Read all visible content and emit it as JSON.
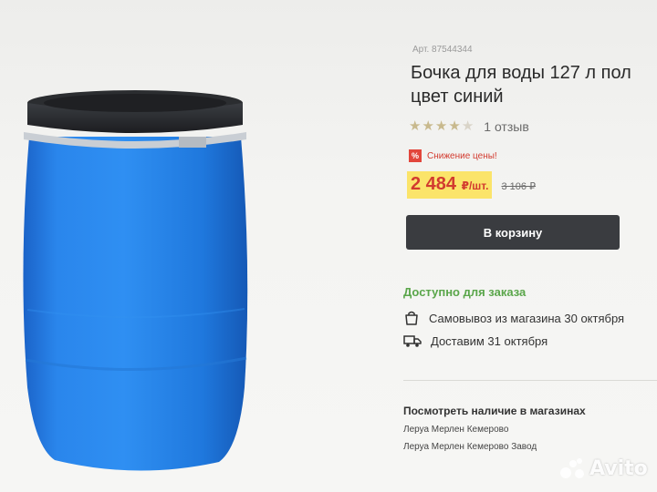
{
  "product": {
    "article": "Арт. 87544344",
    "title_line1": "Бочка для воды 127 л пол",
    "title_line2": "цвет синий",
    "rating": 4,
    "rating_max": 5,
    "reviews": "1 отзыв",
    "promo_badge": "%",
    "promo_text": "Снижение цены!",
    "price": "2 484",
    "price_unit": "₽/шт.",
    "old_price": "3 106 ₽",
    "cart_button": "В корзину"
  },
  "availability": {
    "status": "Доступно для заказа",
    "pickup": "Самовывоз из магазина 30 октября",
    "delivery": "Доставим 31 октября"
  },
  "stores": {
    "title": "Посмотреть наличие в магазинах",
    "items": [
      "Леруа Мерлен Кемерово",
      "Леруа Мерлен Кемерово Завод"
    ]
  },
  "watermark": {
    "text": "Avito"
  },
  "colors": {
    "promo_red": "#d23b2f",
    "price_highlight": "#fbe46a",
    "available_green": "#5aa64a",
    "button_dark": "#3a3c40",
    "barrel_blue": "#1f7fe0"
  }
}
